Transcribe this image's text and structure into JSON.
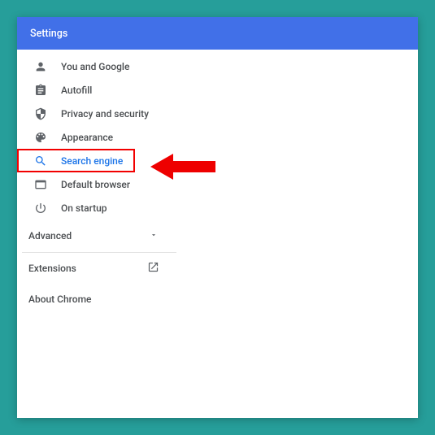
{
  "title": "Settings",
  "nav": {
    "you_and_google": "You and Google",
    "autofill": "Autofill",
    "privacy": "Privacy and security",
    "appearance": "Appearance",
    "search_engine": "Search engine",
    "default_browser": "Default browser",
    "on_startup": "On startup"
  },
  "advanced": "Advanced",
  "extensions": "Extensions",
  "about": "About Chrome"
}
